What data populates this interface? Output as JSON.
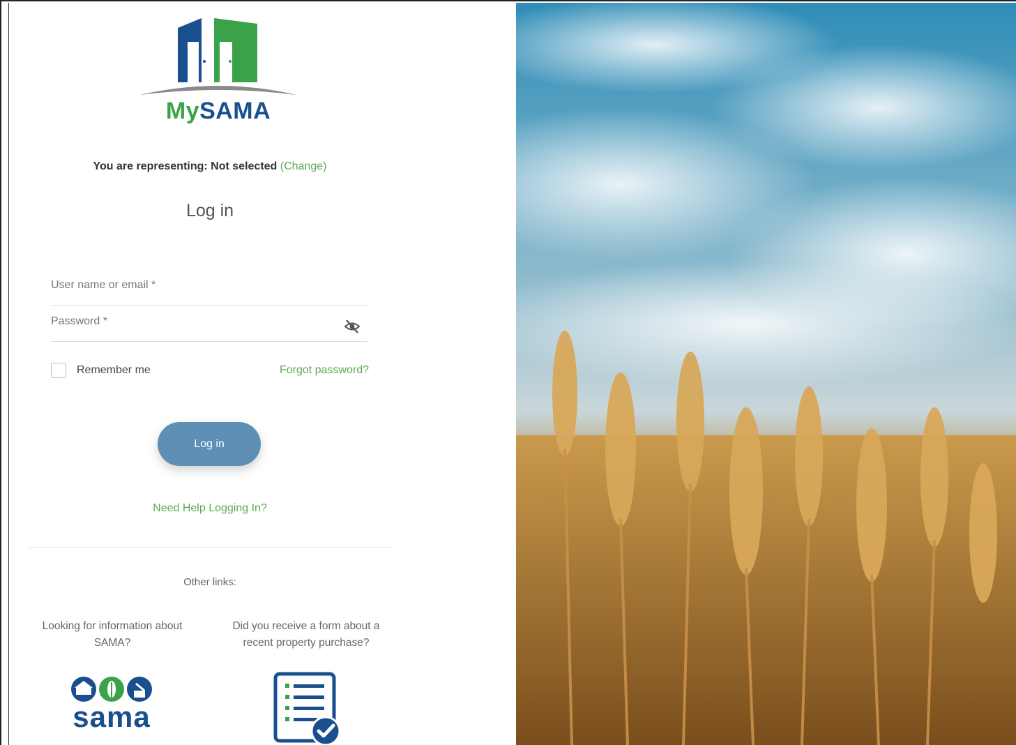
{
  "brand": {
    "logo_my": "My",
    "logo_sama": "SAMA",
    "colors": {
      "green": "#3aa34a",
      "blue": "#1a4f8f",
      "button": "#5e8fb4",
      "link": "#5aab50"
    }
  },
  "representing": {
    "prefix": "You are representing:",
    "value": "Not selected",
    "change_link": "Change"
  },
  "form": {
    "title": "Log in",
    "username_label": "User name or email *",
    "password_label": "Password *",
    "eye_icon": "eye-slash-icon",
    "remember_label": "Remember me",
    "forgot_link": "Forgot password?",
    "submit_label": "Log in",
    "help_link": "Need Help Logging In?"
  },
  "other_links": {
    "heading": "Other links:",
    "left_text": "Looking for information about SAMA?",
    "right_text": "Did you receive a form about a recent property purchase?",
    "sama_word": "sama"
  },
  "background_image": "wheat-field-under-blue-sky"
}
